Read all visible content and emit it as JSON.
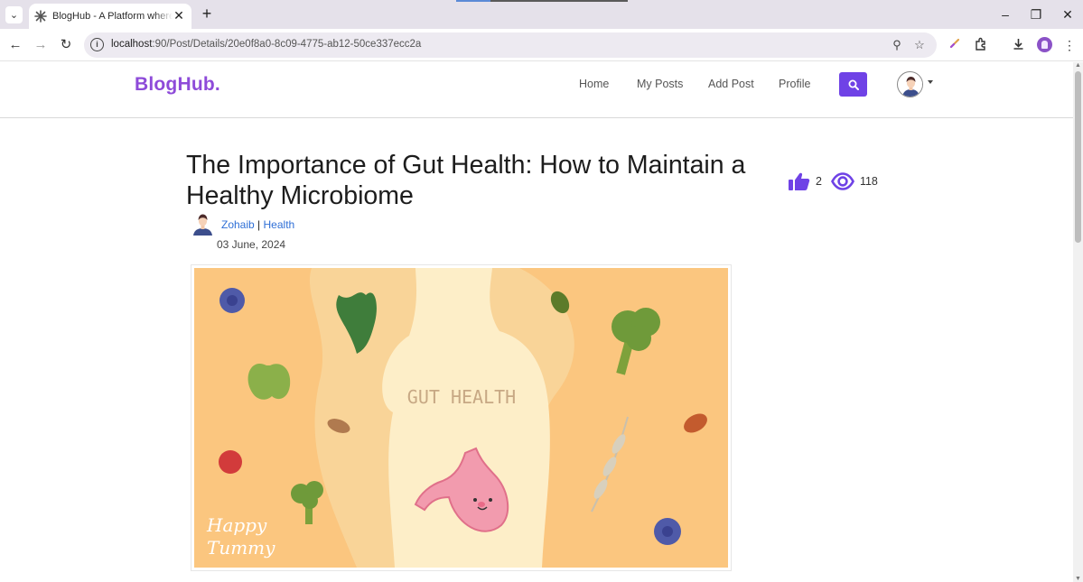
{
  "browser": {
    "tab_title": "BlogHub - A Platform where you",
    "url_host": "localhost",
    "url_rest": ":90/Post/Details/20e0f8a0-8c09-4775-ab12-50ce337ecc2a"
  },
  "site": {
    "brand": "BlogHub.",
    "nav": [
      "Home",
      "My Posts",
      "Add Post",
      "Profile"
    ]
  },
  "post": {
    "title": "The Importance of Gut Health: How to Maintain a Healthy Microbiome",
    "likes": "2",
    "views": "118",
    "author": "Zohaib",
    "separator": "|",
    "category": "Health",
    "date": "03 June, 2024",
    "image_text": "GUT HEALTH",
    "image_logo_line1": "Happy",
    "image_logo_line2": "Tummy"
  },
  "colors": {
    "brand": "#8e4bd9",
    "accent": "#6f42e6",
    "link": "#2f6fd6",
    "image_bg": "#fbc67f"
  },
  "icons": [
    "search-icon",
    "thumbs-up-icon",
    "eye-icon",
    "user-avatar-icon",
    "info-icon",
    "zoom-icon",
    "star-icon",
    "extensions-icon",
    "download-icon"
  ]
}
